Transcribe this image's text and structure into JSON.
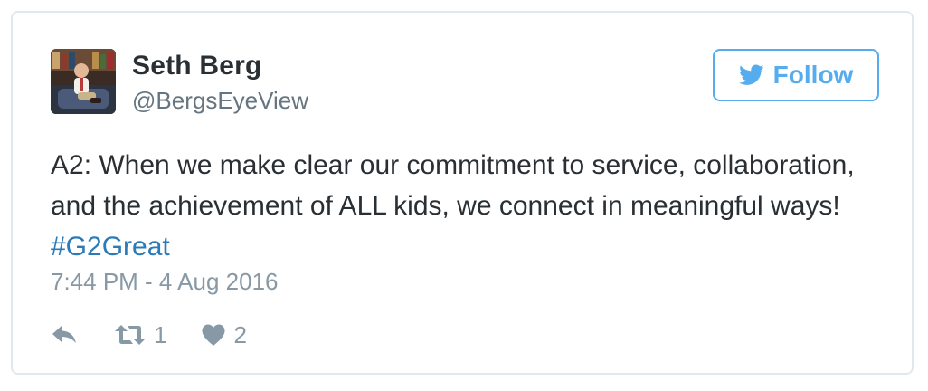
{
  "author": {
    "name": "Seth Berg",
    "handle": "@BergsEyeView",
    "avatar_icon": "profile-photo"
  },
  "follow_button": {
    "label": "Follow",
    "icon": "twitter-bird-icon",
    "color": "#55acee"
  },
  "tweet": {
    "text_before_hashtag": "A2: When we make clear our commitment to service, collaboration, and the achievement of ALL kids, we connect in meaningful ways! ",
    "hashtag": "#G2Great",
    "hashtag_color": "#2b7bb9",
    "timestamp": "7:44 PM - 4 Aug 2016"
  },
  "actions": {
    "reply_icon": "reply-icon",
    "retweet_icon": "retweet-icon",
    "retweet_count": "1",
    "like_icon": "heart-icon",
    "like_count": "2"
  }
}
